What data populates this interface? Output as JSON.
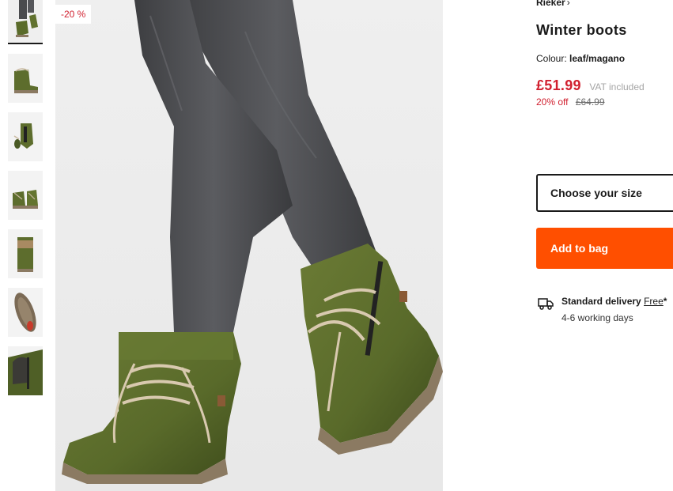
{
  "product": {
    "brand": "Rieker",
    "brand_chevron": "›",
    "title": "Winter boots",
    "colour_label": "Colour:",
    "colour_value": "leaf/magano",
    "price": "£51.99",
    "vat_note": "VAT included",
    "discount_text": "20% off",
    "original_price": "£64.99",
    "discount_badge": "-20 %"
  },
  "actions": {
    "size_placeholder": "Choose your size",
    "add_to_bag": "Add to bag"
  },
  "delivery": {
    "label": "Standard delivery",
    "price": "Free",
    "asterisk": "*",
    "time": "4-6 working days"
  },
  "colors": {
    "accent": "#ff4f00",
    "sale_red": "#d1202f",
    "boot_green": "#5a6b2a",
    "jeans_grey": "#4a4b4e"
  },
  "icons": {
    "delivery": "truck-icon"
  },
  "gallery": {
    "thumbnail_count": 7,
    "active_index": 0
  }
}
